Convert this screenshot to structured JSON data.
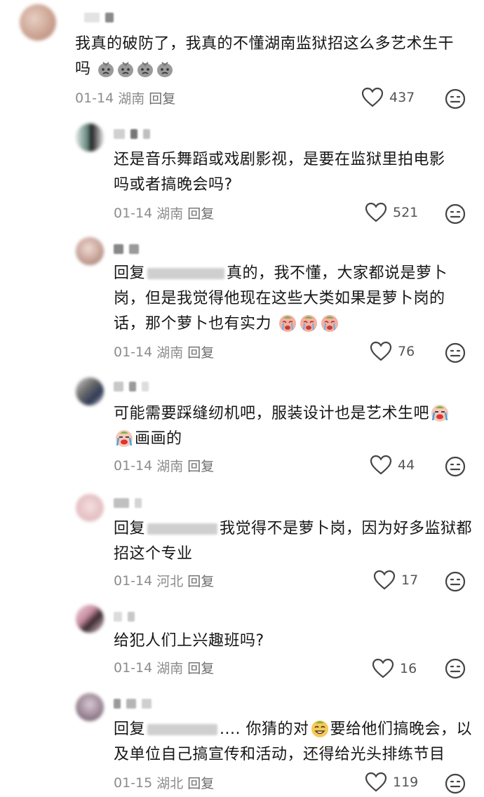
{
  "comments": [
    {
      "id": "c1",
      "lines": [
        "我真的破防了，我真的不懂湖南监狱招这么多艺术生干",
        "吗"
      ],
      "date": "01-14",
      "region": "湖南",
      "reply_label": "回复",
      "likes": "437",
      "emoji_after_line2": "cry-sack-emoji",
      "emoji_count": 4
    },
    {
      "id": "c2",
      "lines": [
        "还是音乐舞蹈或戏剧影视，是要在监狱里拍电影",
        "吗或者搞晚会吗?"
      ],
      "date": "01-14",
      "region": "湖南",
      "reply_label": "回复",
      "likes": "521"
    },
    {
      "id": "c3",
      "reply_prefix": "回复",
      "line1_tail": "真的，我不懂，大家都说是萝卜",
      "lines": [
        "岗，但是我觉得他现在这些大类如果是萝卜岗的",
        "话，那个萝卜也有实力"
      ],
      "date": "01-14",
      "region": "湖南",
      "reply_label": "回复",
      "likes": "76",
      "emoji": "crying-face-emoji",
      "emoji_count": 3
    },
    {
      "id": "c4",
      "lines": [
        "可能需要踩缝纫机吧，服装设计也是艺术生吧",
        "画画的"
      ],
      "date": "01-14",
      "region": "湖南",
      "reply_label": "回复",
      "likes": "44",
      "emoji": "loudly-crying-emoji"
    },
    {
      "id": "c5",
      "reply_prefix": "回复",
      "line1_tail": "我觉得不是萝卜岗，因为好多监狱都",
      "lines": [
        "招这个专业"
      ],
      "date": "01-14",
      "region": "河北",
      "reply_label": "回复",
      "likes": "17"
    },
    {
      "id": "c6",
      "lines": [
        "给犯人们上兴趣班吗?"
      ],
      "date": "01-14",
      "region": "湖南",
      "reply_label": "回复",
      "likes": "16"
    },
    {
      "id": "c7",
      "reply_prefix": "回复",
      "line1_ellipsis": "....",
      "line1_mid": "你猜的对",
      "line1_tail": "要给他们搞晚会，以",
      "lines": [
        "及单位自己搞宣传和活动，还得给光头排练节目"
      ],
      "date": "01-15",
      "region": "湖北",
      "reply_label": "回复",
      "likes": "119",
      "emoji": "sly-grin-emoji"
    }
  ]
}
